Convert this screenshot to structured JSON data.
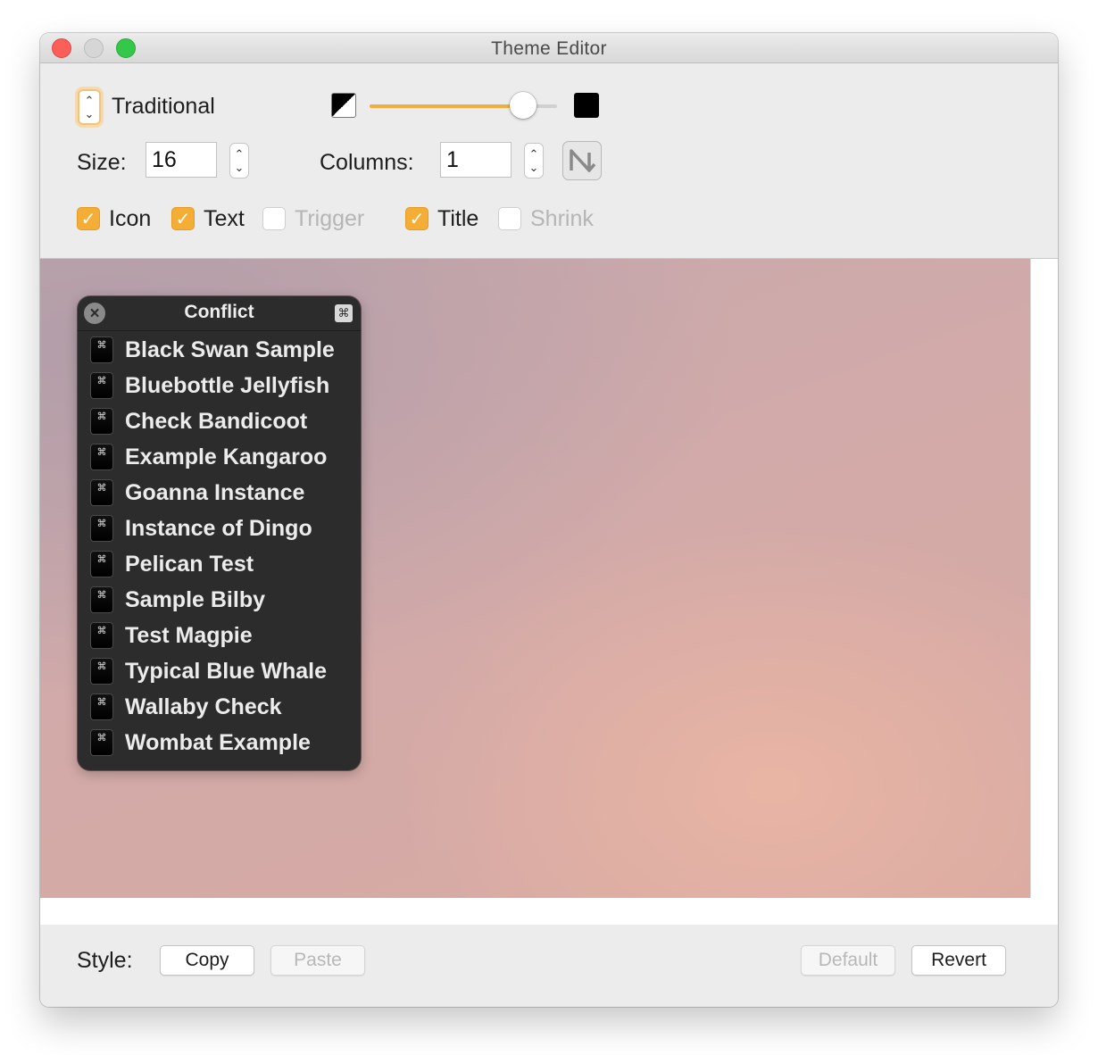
{
  "window": {
    "title": "Theme Editor"
  },
  "toolbar": {
    "style_selector": "Traditional",
    "size_label": "Size:",
    "size_value": "16",
    "columns_label": "Columns:",
    "columns_value": "1",
    "opacity_fraction": 0.82,
    "checkboxes": [
      {
        "label": "Icon",
        "checked": true,
        "enabled": true
      },
      {
        "label": "Text",
        "checked": true,
        "enabled": true
      },
      {
        "label": "Trigger",
        "checked": false,
        "enabled": false
      },
      {
        "label": "Title",
        "checked": true,
        "enabled": true
      },
      {
        "label": "Shrink",
        "checked": false,
        "enabled": false
      }
    ]
  },
  "preview": {
    "panel_title": "Conflict",
    "items": [
      "Black Swan Sample",
      "Bluebottle Jellyfish",
      "Check Bandicoot",
      "Example Kangaroo",
      "Goanna Instance",
      "Instance of Dingo",
      "Pelican Test",
      "Sample Bilby",
      "Test Magpie",
      "Typical Blue Whale",
      "Wallaby Check",
      "Wombat Example"
    ]
  },
  "footer": {
    "style_label": "Style:",
    "copy_label": "Copy",
    "paste_label": "Paste",
    "default_label": "Default",
    "revert_label": "Revert"
  },
  "icons": {
    "close_glyph": "×",
    "command_glyph": "⌘",
    "checkmark_glyph": "✓"
  },
  "colors": {
    "accent": "#f2ae3c",
    "hud_background": "#2d2c2c"
  }
}
